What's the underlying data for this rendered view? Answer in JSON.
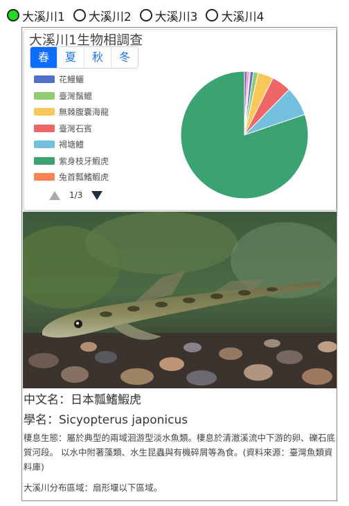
{
  "radios": [
    {
      "label": "大溪川1",
      "selected": true
    },
    {
      "label": "大溪川2",
      "selected": false
    },
    {
      "label": "大溪川3",
      "selected": false
    },
    {
      "label": "大溪川4",
      "selected": false
    }
  ],
  "card": {
    "title": "大溪川1生物相調查",
    "tabs": [
      "春",
      "夏",
      "秋",
      "冬"
    ],
    "active_tab": "春",
    "legend": [
      {
        "label": "花鰻鱺",
        "color": "#5470c6"
      },
      {
        "label": "臺灣鬚鱲",
        "color": "#91cc75"
      },
      {
        "label": "無棘腹囊海龍",
        "color": "#fac858"
      },
      {
        "label": "臺灣石賓",
        "color": "#ee6666"
      },
      {
        "label": "褐塘鱧",
        "color": "#73c0de"
      },
      {
        "label": "紫身枝牙鰕虎",
        "color": "#3ba272"
      },
      {
        "label": "兔首瓢鰭鰕虎",
        "color": "#fc8452"
      }
    ],
    "pager": "1/3"
  },
  "chart_data": {
    "type": "pie",
    "slices": [
      {
        "label": "紫身枝牙鰕虎",
        "value": 81.0,
        "color": "#3ba272"
      },
      {
        "label": "褐塘鱧",
        "value": 7.5,
        "color": "#73c0de"
      },
      {
        "label": "臺灣石賓",
        "value": 5.0,
        "color": "#ee6666"
      },
      {
        "label": "無棘腹囊海龍",
        "value": 4.0,
        "color": "#fac858"
      },
      {
        "label": "臺灣鬚鱲",
        "value": 1.2,
        "color": "#91cc75"
      },
      {
        "label": "花鰻鱺",
        "value": 0.8,
        "color": "#5470c6"
      },
      {
        "value": 0.7,
        "color": "#9a60b4"
      },
      {
        "value": 0.5,
        "color": "#ea7ccc"
      },
      {
        "value": 0.3,
        "color": "#fc8452"
      }
    ]
  },
  "species": {
    "name_zh": "中文名：日本瓢鰭鰕虎",
    "name_sci": "學名：Sicyopterus japonicus",
    "ecology": "棲息生態：屬於典型的兩域洄游型淡水魚類。棲息於清澈溪流中下游的卵、礫石底質河段。 以水中附著藻類、水生昆蟲與有機碎屑等為食。(資料來源：臺灣魚類資料庫)",
    "distribution": "大溪川分布區域：扇形堰以下區域。"
  }
}
